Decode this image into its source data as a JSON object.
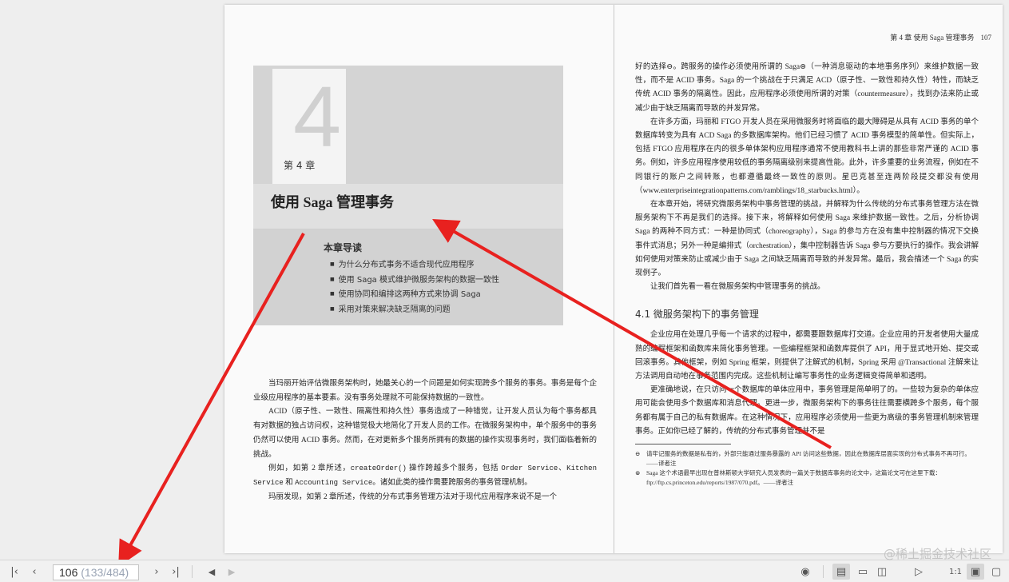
{
  "left_page": {
    "chapter_number": "4",
    "chapter_label": "第 4 章",
    "chapter_title": "使用 Saga 管理事务",
    "intro_heading": "本章导读",
    "intro_items": [
      "为什么分布式事务不适合现代应用程序",
      "使用 Saga 模式维护微服务架构的数据一致性",
      "使用协同和编排这两种方式来协调 Saga",
      "采用对策来解决缺乏隔离的问题"
    ],
    "paragraphs": [
      "当玛丽开始评估微服务架构时，她最关心的一个问题是如何实现跨多个服务的事务。事务是每个企业级应用程序的基本要素。没有事务处理就不可能保持数据的一致性。",
      "ACID（原子性、一致性、隔离性和持久性）事务造成了一种错觉，让开发人员认为每个事务都具有对数据的独占访问权，这种错觉极大地简化了开发人员的工作。在微服务架构中，单个服务中的事务仍然可以使用 ACID 事务。然而，在对更新多个服务所拥有的数据的操作实现事务时，我们面临着新的挑战。",
      "玛丽发现，如第 2 章所述，传统的分布式事务管理方法对于现代应用程序来说不是一个"
    ],
    "para3_prefix": "例如，如第 2 章所述，",
    "para3_code1": "createOrder()",
    "para3_mid1": " 操作跨越多个服务，包括 ",
    "para3_code2": "Order Service",
    "para3_mid2": "、",
    "para3_code3": "Kitchen Service",
    "para3_mid3": " 和 ",
    "para3_code4": "Accounting Service",
    "para3_suffix": "。诸如此类的操作需要跨服务的事务管理机制。"
  },
  "right_page": {
    "running_head": "第 4 章  使用 Saga 管理事务",
    "page_number": "107",
    "paragraphs": [
      "好的选择⊖。跨服务的操作必须使用所谓的 Saga⊜（一种消息驱动的本地事务序列）来维护数据一致性，而不是 ACID 事务。Saga 的一个挑战在于只满足 ACD（原子性、一致性和持久性）特性，而缺乏传统 ACID 事务的隔离性。因此，应用程序必须使用所谓的对策（countermeasure），找到办法来防止或减少由于缺乏隔离而导致的并发异常。",
      "在许多方面，玛丽和 FTGO 开发人员在采用微服务时将面临的最大障碍是从具有 ACID 事务的单个数据库转变为具有 ACD Saga 的多数据库架构。他们已经习惯了 ACID 事务模型的简单性。但实际上，包括 FTGO 应用程序在内的很多单体架构应用程序通常不使用教科书上讲的那些非常严谨的 ACID 事务。例如，许多应用程序使用较低的事务隔离级别来提高性能。此外，许多重要的业务流程，例如在不同银行的账户之间转账，也都遵循最终一致性的原则。星巴克甚至连两阶段提交都没有使用（www.enterpriseintegrationpatterns.com/ramblings/18_starbucks.html）。",
      "在本章开始，将研究微服务架构中事务管理的挑战，并解释为什么传统的分布式事务管理方法在微服务架构下不再是我们的选择。接下来，将解释如何使用 Saga 来维护数据一致性。之后，分析协调 Saga 的两种不同方式：一种是协同式（choreography），Saga 的参与方在没有集中控制器的情况下交换事件式消息；另外一种是编排式（orchestration），集中控制器告诉 Saga 参与方要执行的操作。我会讲解如何使用对策来防止或减少由于 Saga 之间缺乏隔离而导致的并发异常。最后，我会描述一个 Saga 的实现例子。",
      "让我们首先看一看在微服务架构中管理事务的挑战。"
    ],
    "section_heading": "4.1   微服务架构下的事务管理",
    "section_paragraphs": [
      "企业应用在处理几乎每一个请求的过程中，都需要跟数据库打交道。企业应用的开发者使用大量成熟的编程框架和函数库来简化事务管理。一些编程框架和函数库提供了 API，用于显式地开始、提交或回滚事务。其他框架，例如 Spring 框架，则提供了注解式的机制，Spring 采用 @Transactional 注解来让方法调用自动地在事务范围内完成。这些机制让编写事务性的业务逻辑变得简单和透明。",
      "更准确地说，在只访问一个数据库的单体应用中，事务管理是简单明了的。一些较为复杂的单体应用可能会使用多个数据库和消息代理。更进一步，微服务架构下的事务往往需要横跨多个服务，每个服务都有属于自己的私有数据库。在这种情况下，应用程序必须使用一些更为高级的事务管理机制来管理事务。正如你已经了解的，传统的分布式事务管理并不是"
    ],
    "footnotes": [
      {
        "mark": "⊖",
        "text": "请牢记服务的数据是私有的，外部只能通过服务暴露的 API 访问这些数据，因此在数据库层面实现的分布式事务不再可行。——译者注"
      },
      {
        "mark": "⊜",
        "text": "Saga 这个术语最早出现在普林斯顿大学研究人员发表的一篇关于数据库事务的论文中，这篇论文可在这里下载：ftp://ftp.cs.princeton.edu/reports/1987/070.pdf。——译者注"
      }
    ]
  },
  "toolbar": {
    "current_page": "106",
    "page_total": " (133/484)",
    "watermark": "@稀土掘金技术社区",
    "icons": [
      "first-page-icon",
      "prev-page-icon",
      "next-page-icon",
      "last-page-icon",
      "back-icon",
      "forward-icon",
      "eye-icon",
      "single-page-icon",
      "document-icon",
      "two-page-icon",
      "play-icon",
      "actual-size-icon",
      "fit-page-icon",
      "fullscreen-icon"
    ]
  },
  "annotation_color": "#e8211f"
}
